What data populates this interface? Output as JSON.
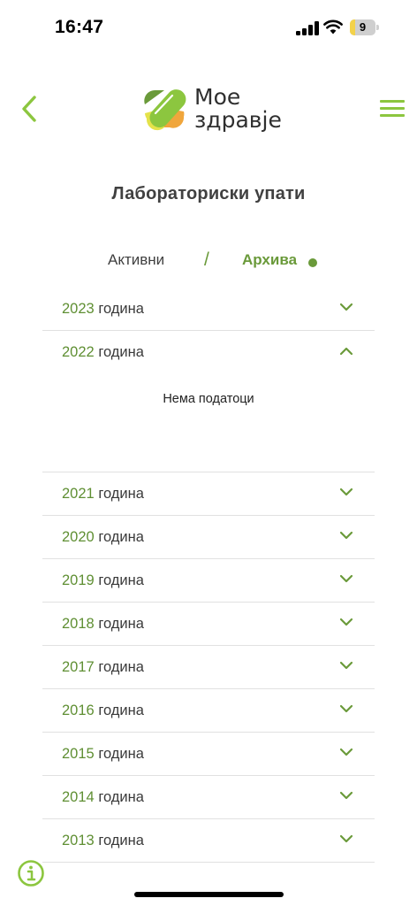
{
  "status": {
    "time": "16:47",
    "battery_level": "9",
    "battery_fraction": 0.2
  },
  "header": {
    "back_icon": "chevron-left-icon",
    "menu_icon": "hamburger-icon",
    "logo": {
      "line1": "Мое",
      "line2": "здравје"
    }
  },
  "page": {
    "title": "Лабораториски упати"
  },
  "tabs": {
    "active_label": "Активни",
    "separator": "/",
    "archive_label": "Архива",
    "selected": "archive"
  },
  "years": [
    {
      "year": "2023",
      "word": "година",
      "expanded": false
    },
    {
      "year": "2022",
      "word": "година",
      "expanded": true,
      "empty_text": "Нема податоци"
    },
    {
      "year": "2021",
      "word": "година",
      "expanded": false
    },
    {
      "year": "2020",
      "word": "година",
      "expanded": false
    },
    {
      "year": "2019",
      "word": "година",
      "expanded": false
    },
    {
      "year": "2018",
      "word": "година",
      "expanded": false
    },
    {
      "year": "2017",
      "word": "година",
      "expanded": false
    },
    {
      "year": "2016",
      "word": "година",
      "expanded": false
    },
    {
      "year": "2015",
      "word": "година",
      "expanded": false
    },
    {
      "year": "2014",
      "word": "година",
      "expanded": false
    },
    {
      "year": "2013",
      "word": "година",
      "expanded": false
    }
  ],
  "colors": {
    "brand_green": "#8cc63f",
    "dark_green": "#5f8f33",
    "logo_orange": "#f0a63c",
    "logo_yellow": "#e4e24a",
    "logo_dark_green": "#6a9a3a"
  },
  "footer": {
    "info_icon": "info-icon"
  }
}
